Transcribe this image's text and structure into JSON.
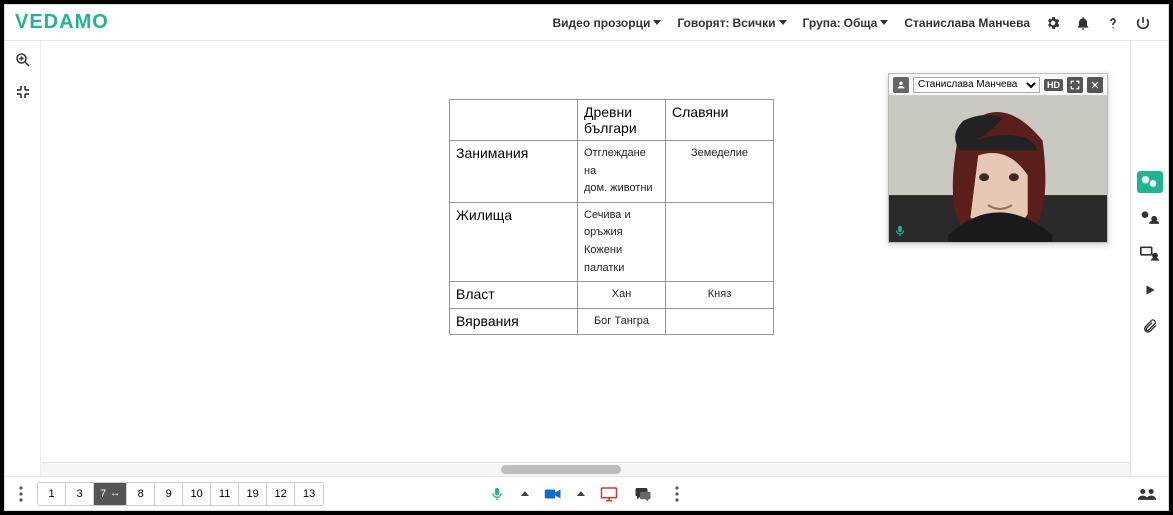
{
  "brand": "VEDAMO",
  "header": {
    "video_windows": "Видео прозорци",
    "speaking_label": "Говорят:",
    "speaking_value": "Всички",
    "group_label": "Група:",
    "group_value": "Обща",
    "user_name": "Станислава Манчева"
  },
  "video_panel": {
    "participant": "Станислава Манчева",
    "hd_badge": "HD"
  },
  "table": {
    "col1_header": "Древни българи",
    "col2_header": "Славяни",
    "rows": [
      {
        "label": "Занимания",
        "col1_line1": "Отглеждане на",
        "col1_line2": "дом. животни",
        "col2": "Земеделие"
      },
      {
        "label": "Жилища",
        "col1_line1": "Сечива и оръжия",
        "col1_line2": "Кожени палатки",
        "col2": ""
      },
      {
        "label": "Власт",
        "col1": "Хан",
        "col2": "Княз"
      },
      {
        "label": "Вярвания",
        "col1": "Бог Тангра",
        "col2": ""
      }
    ]
  },
  "pages": {
    "items": [
      "1",
      "3",
      "7",
      "8",
      "9",
      "10",
      "11",
      "19",
      "12",
      "13"
    ],
    "active": "7"
  }
}
